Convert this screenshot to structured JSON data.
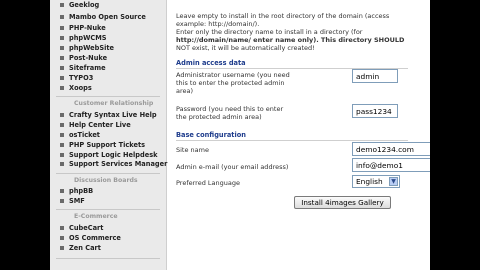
{
  "sidebar": {
    "top_items": [
      "Geeklog",
      "Mambo Open Source",
      "PHP-Nuke",
      "phpWCMS",
      "phpWebSite",
      "Post-Nuke",
      "Siteframe",
      "TYPO3",
      "Xoops"
    ],
    "customer_relationship": {
      "heading": "Customer Relationship",
      "items": [
        "Crafty Syntax Live Help",
        "Help Center Live",
        "osTicket",
        "PHP Support Tickets",
        "Support Logic Helpdesk",
        "Support Services Manager"
      ]
    },
    "discussion_boards": {
      "heading": "Discussion Boards",
      "items": [
        "phpBB",
        "SMF"
      ]
    },
    "ecommerce": {
      "heading": "E-Commerce",
      "items": [
        "CubeCart",
        "OS Commerce",
        "Zen Cart"
      ]
    }
  },
  "main": {
    "dir_help": [
      "Leave empty to install in the root directory of the domain (access",
      "example: http://domain/).",
      "Enter only the directory name to install in a directory (for",
      "http://domain/name/ enter name only). This directory SHOULD",
      "NOT exist, it will be automatically created!"
    ],
    "admin_section": "Admin access data",
    "admin_user_label": [
      "Administrator username (you need",
      "this to enter the protected admin",
      "area)"
    ],
    "admin_user_value": "admin",
    "password_label": [
      "Password (you need this to enter",
      "the protected admin area)"
    ],
    "password_value": "pass1234",
    "base_section": "Base configuration",
    "site_name_label": "Site name",
    "site_name_value": "demo1234.com",
    "admin_email_label": "Admin e-mail (your email address)",
    "admin_email_value": "info@demo1",
    "language_label": "Preferred Language",
    "language_value": "English",
    "install_button": "Install 4images Gallery"
  },
  "colors": {
    "section_heading": "#1e3c8c",
    "sidebar_bg": "#eaeaea",
    "field_border": "#7f9db9"
  },
  "icons": {
    "cursor": "mouse-pointer-icon",
    "bullet": "square-bullet-icon",
    "dropdown": "chevron-down-icon"
  }
}
